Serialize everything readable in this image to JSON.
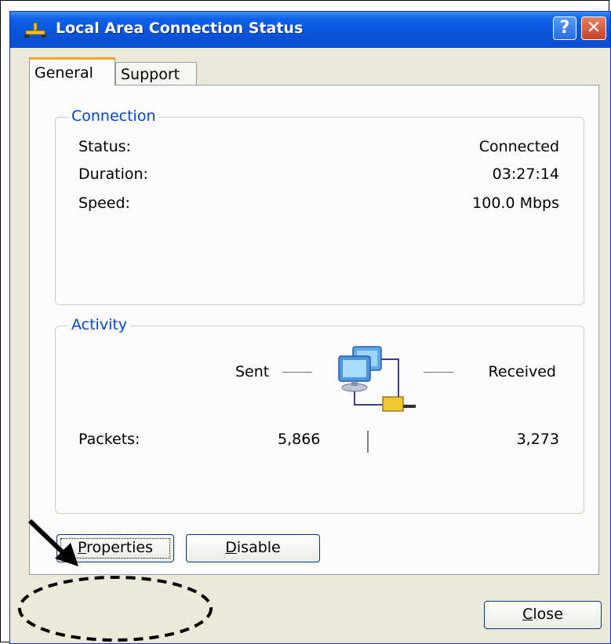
{
  "window": {
    "title": "Local Area Connection Status",
    "help_glyph": "?",
    "close_glyph": "✕"
  },
  "tabs": [
    {
      "label": "General",
      "selected": true
    },
    {
      "label": "Support",
      "selected": false
    }
  ],
  "connection": {
    "legend": "Connection",
    "rows": [
      {
        "label": "Status:",
        "value": "Connected"
      },
      {
        "label": "Duration:",
        "value": "03:27:14"
      },
      {
        "label": "Speed:",
        "value": "100.0 Mbps"
      }
    ]
  },
  "activity": {
    "legend": "Activity",
    "sent_label": "Sent",
    "received_label": "Received",
    "packets_label": "Packets:",
    "packets_sent": "5,866",
    "packets_received": "3,273"
  },
  "buttons": {
    "properties": {
      "mnemonic": "P",
      "rest": "roperties"
    },
    "disable": {
      "mnemonic": "D",
      "rest": "isable"
    },
    "close": {
      "mnemonic": "C",
      "rest": "lose"
    }
  },
  "colors": {
    "titlebar": "#0a52d8",
    "legend_text": "#0046d5",
    "tab_highlight": "#f5a623",
    "dialog_bg": "#ece9d8"
  },
  "icons": {
    "title_icon": "network-connection-icon",
    "activity_icon": "network-computers-icon"
  }
}
